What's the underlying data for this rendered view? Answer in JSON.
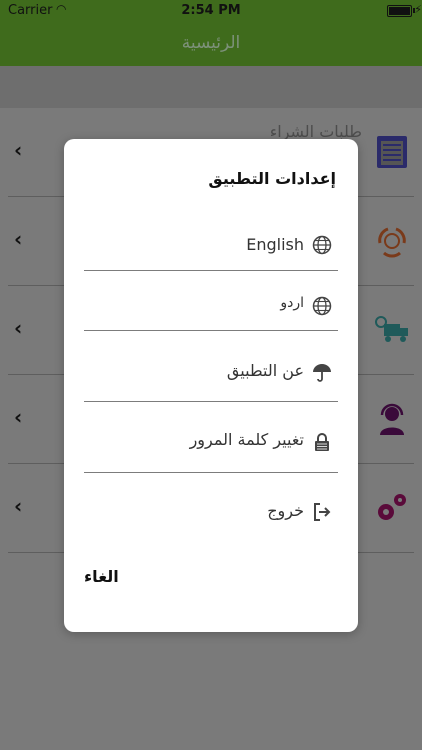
{
  "status": {
    "carrier": "Carrier",
    "time": "2:54 PM"
  },
  "nav": {
    "title": "الرئيسية"
  },
  "background_list": [
    {
      "label": "طلبات الشراء",
      "icon": "document-list-icon"
    },
    {
      "label": "",
      "icon": "recycle-globe-icon"
    },
    {
      "label": "",
      "icon": "delivery-truck-icon"
    },
    {
      "label": "",
      "icon": "support-agent-icon"
    },
    {
      "label": "",
      "icon": "gears-icon"
    }
  ],
  "dialog": {
    "title": "إعدادات التطبيق",
    "options": [
      {
        "label": "English",
        "icon": "globe-icon"
      },
      {
        "label": "اردو",
        "icon": "globe-icon"
      },
      {
        "label": "عن التطبيق",
        "icon": "umbrella-icon"
      },
      {
        "label": "تغيير كلمة المرور",
        "icon": "lock-icon"
      },
      {
        "label": "خروج",
        "icon": "logout-icon"
      }
    ],
    "cancel_label": "الغاء"
  },
  "colors": {
    "nav_green": "#5aa02c",
    "overlay": "#7a7a7a"
  }
}
